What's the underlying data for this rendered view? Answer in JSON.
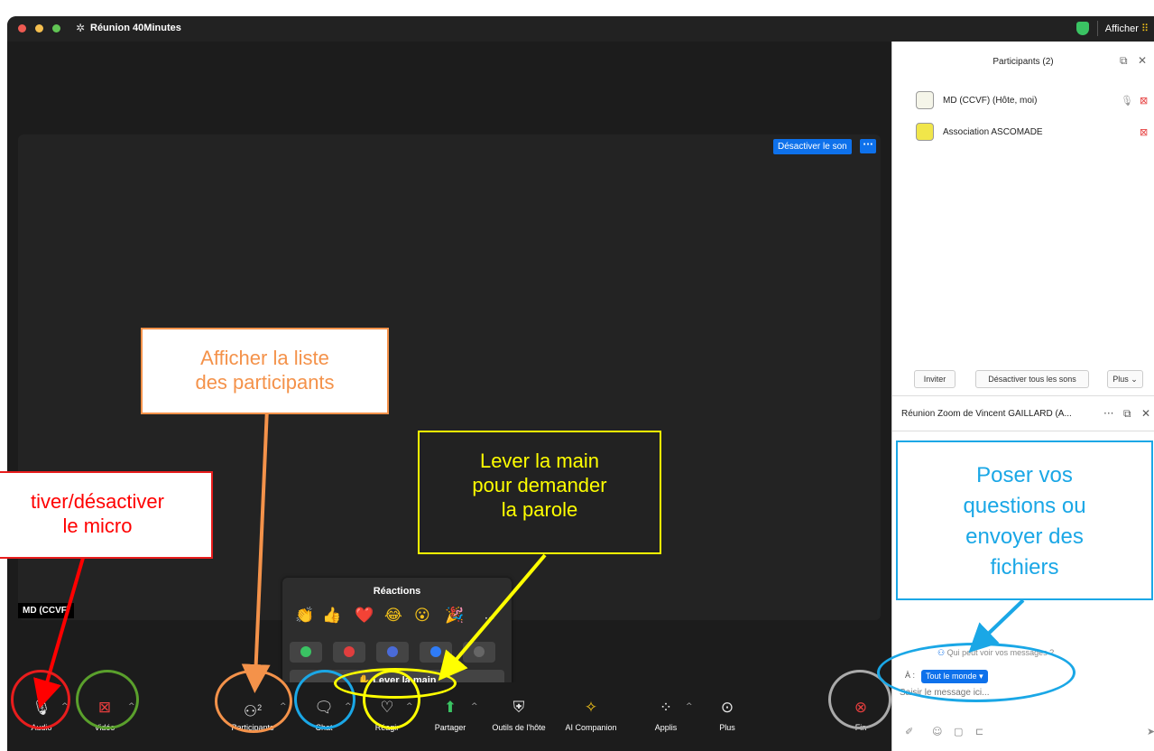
{
  "window": {
    "title": "Réunion 40Minutes",
    "view_label": "Afficher",
    "traffic_lights": [
      "#ee5a52",
      "#f5bf4f",
      "#61c554"
    ]
  },
  "video": {
    "mute_button": "Désactiver le son",
    "more_button": "···",
    "name_tag": "MD (CCVF)"
  },
  "reactions": {
    "title": "Réactions",
    "emojis": [
      "👏",
      "👍",
      "❤️",
      "😂",
      "😮",
      "🎉",
      "···"
    ],
    "feedback_colors": [
      "#3ac363",
      "#e03e3e",
      "#4a6bd8",
      "#2f7cf6",
      "#666666"
    ],
    "raise_hand": "✋ Lever la main"
  },
  "toolbar": {
    "audio": "Audio",
    "video": "Vidéo",
    "participants": "Participants",
    "participants_count": "2",
    "chat": "Chat",
    "react": "Réagir",
    "share": "Partager",
    "host_tools": "Outils de l'hôte",
    "ai_companion": "AI Companion",
    "apps": "Applis",
    "more": "Plus",
    "end": "Fin"
  },
  "participants_panel": {
    "title": "Participants (2)",
    "participants": [
      {
        "name": "MD (CCVF) (Hôte, moi)"
      },
      {
        "name": "Association ASCOMADE"
      }
    ],
    "invite": "Inviter",
    "mute_all": "Désactiver tous les sons",
    "more": "Plus"
  },
  "chat_panel": {
    "title": "Réunion Zoom de Vincent GAILLARD (A...",
    "who_can_see": "Qui peut voir vos messages ?",
    "to_label": "À :",
    "recipient": "Tout le monde",
    "placeholder": "Saisir le message ici..."
  },
  "annotations": {
    "micro": {
      "line1": "tiver/désactiver",
      "line2": "le micro",
      "color": "#ff0000"
    },
    "participants": {
      "line1": "Afficher la liste",
      "line2": "des participants",
      "color": "#f4924a"
    },
    "raise_hand": {
      "line1": "Lever la main",
      "line2": "pour demander",
      "line3": "la parole",
      "color": "#ffff00"
    },
    "chat": {
      "line1": "Poser vos",
      "line2": "questions ou",
      "line3": "envoyer des",
      "line4": "fichiers",
      "color": "#1aa7e6"
    }
  }
}
